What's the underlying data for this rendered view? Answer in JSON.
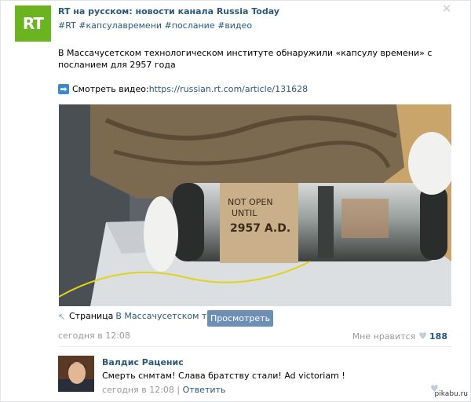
{
  "post": {
    "logo_text": "RT",
    "author": "RT на русском: новости канала Russia Today",
    "tags": "#RT #капсулавремени #послание #видео",
    "text": "В Массачусетском технологическом институте обнаружили «капсулу времени» с посланием для 2957 года",
    "video_prefix": "Смотреть видео: ",
    "video_link": "https://russian.rt.com/article/131628",
    "photo_label": "NOT OPEN UNTIL 2957 A.D.",
    "page_label": "Страница",
    "page_link": "В Массачусетском техн..",
    "view_button": "Просмотреть",
    "date": "сегодня в 12:08",
    "like_label": "Мне нравится",
    "like_count": "188"
  },
  "comment": {
    "author": "Валдис Раценис",
    "text": "Смерть снмтам! Слава братству стали! Ad victoriam !",
    "date": "сегодня в 12:08",
    "separator": " | ",
    "reply": "Ответить"
  },
  "watermark": "pikabu.ru",
  "colors": {
    "rt_green": "#6ab51f",
    "link": "#2b587a",
    "button": "#6d8fb3"
  }
}
